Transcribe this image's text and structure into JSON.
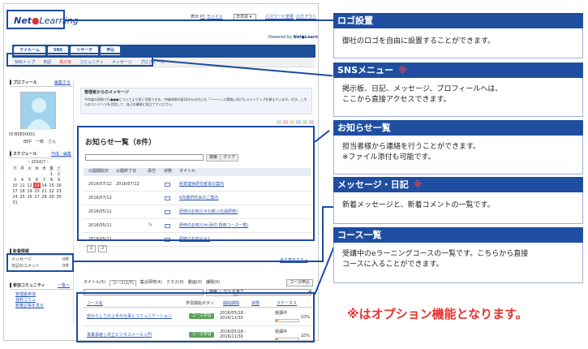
{
  "topbar": {
    "links": [
      "表示",
      "PC",
      "モバイル"
    ],
    "lang": "日本語",
    "password_link": "パスワード変更",
    "logout": "ログアウト",
    "powered": "Powered by",
    "logo_text": "Net",
    "logo_rest": "Learning"
  },
  "tabs": [
    "マイルーム",
    "SNS",
    "リサーチ",
    "申込"
  ],
  "subtabs": [
    "SNSトップ",
    "日記",
    "掲示板",
    "コミュニティ",
    "メッセージ",
    "プロフィール"
  ],
  "profile": {
    "title": "プロフィール",
    "edit": "編集する",
    "id": "ID:BSE00001",
    "name": "田中　一郎　さん"
  },
  "schedule": {
    "title": "スケジュール",
    "links": "作成・編集",
    "month": "2016/7",
    "weekdays": [
      "日",
      "月",
      "火",
      "水",
      "木",
      "金",
      "土"
    ],
    "weeks": [
      [
        "",
        "",
        "",
        "",
        "",
        "1",
        "2"
      ],
      [
        "3",
        "4",
        "5",
        "6",
        "7",
        "8",
        "9"
      ],
      [
        "10",
        "11",
        "12",
        "13",
        "14",
        "15",
        "16"
      ],
      [
        "17",
        "18",
        "19",
        "20",
        "21",
        "22",
        "23"
      ],
      [
        "24",
        "25",
        "26",
        "27",
        "28",
        "29",
        "30"
      ],
      [
        "31",
        "",
        "",
        "",
        "",
        "",
        ""
      ]
    ],
    "today": "13"
  },
  "unread": {
    "title": "新着情報",
    "rows": [
      {
        "label": "メッセージ",
        "count": "0件"
      },
      {
        "label": "日記のコメント",
        "count": "0件"
      }
    ]
  },
  "community": {
    "title": "参加コミュニティ",
    "more": "一覧へ",
    "items": [
      "管理者参加",
      "資料コミュ",
      "新着記事を見る"
    ]
  },
  "admin_msg": {
    "title": "管理者からのメッセージ",
    "body": "今年度の研修で行●●●についてより深く学習できる、中級研修計画10のもの方にも「〜〜〜」の実践に向けたラインナップを揃えています。ぜひ、こちらのコンテンツを活用して、自己の業務に役立ててください。"
  },
  "notice": {
    "title": "お知らせ一覧（8件）",
    "search_btn": "検索",
    "clear_btn": "クリア",
    "headers": [
      "公開開始日",
      "公開終了日",
      "添付",
      "状態",
      "タイトル"
    ],
    "rows": [
      {
        "start": "2016/07/12",
        "end": "2016/07/12",
        "title": "秋季連休研究者事の案内"
      },
      {
        "start": "2016/07/12",
        "end": "",
        "title": "6月度研究会のご案内"
      },
      {
        "start": "2016/05/11",
        "end": "",
        "title": "研修のお知らせ1(新入社員研修)"
      },
      {
        "start": "2016/05/11",
        "end": "",
        "title": "研修のお知らせ(添付:技術コース一覧)"
      },
      {
        "start": "2016/05/11",
        "end": "",
        "title": "研修のお知らせ1"
      }
    ],
    "pages": [
      "1",
      "2"
    ],
    "all_link": "全て表示する→"
  },
  "courses": {
    "tabs": [
      "タイトル(5)",
      "コース(2/7)",
      "集合研修(4)",
      "クラス(0)",
      "動画(0)",
      "課題(0)"
    ],
    "apply": "コース申込",
    "search_btn": "検索",
    "clear_btn": "クリア",
    "filter": "全て",
    "headers": [
      "コース名",
      "学習開始ボタン",
      "開始期間",
      "状態",
      "ステータス"
    ],
    "rows": [
      {
        "name": "自分らしさの上手な仕事とコミュニケーション",
        "button": "コース学習",
        "period": "2016/05/18 - 2016/11/30",
        "status": "受講中",
        "pct": "10%",
        "progress": 0.1
      },
      {
        "name": "事業承継 | 共立ビジネスメール入門",
        "button": "コース学習",
        "period": "2016/05/18 - 2016/11/30",
        "status": "受講中",
        "pct": "10%",
        "progress": 0.1
      }
    ]
  },
  "callouts": [
    {
      "title": "ロゴ設置",
      "mark": "",
      "body": "御社のロゴを自由に設置することができます。"
    },
    {
      "title": "SNSメニュー",
      "mark": "※",
      "body": "掲示板、日記、メッセージ、プロフィールへは、\nここから直接アクセスできます。"
    },
    {
      "title": "お知らせ一覧",
      "mark": "",
      "body": "担当者様から連絡を行うことができます。\n※ファイル添付も可能です。"
    },
    {
      "title": "メッセージ・日記",
      "mark": "※",
      "body": "新着メッセージと、新着コメントの一覧です。"
    },
    {
      "title": "コース一覧",
      "mark": "",
      "body": "受講中のeラーニングコースの一覧です。こちらから直接\nコースに入ることができます。"
    }
  ],
  "footnote": "※はオプション機能となります。"
}
